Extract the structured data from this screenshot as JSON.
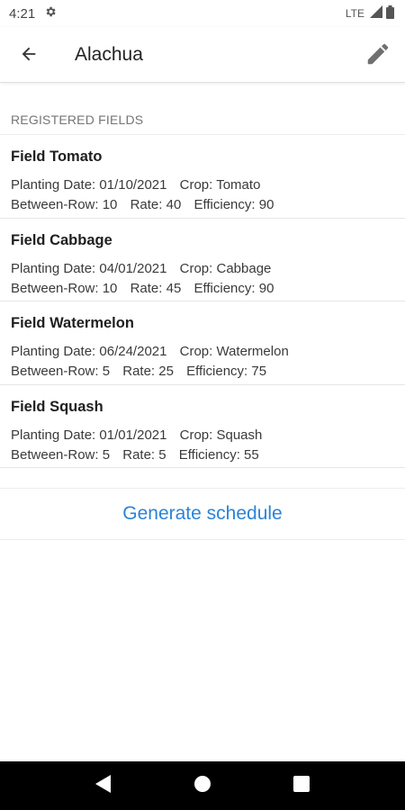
{
  "status_bar": {
    "time": "4:21",
    "network": "LTE"
  },
  "app_bar": {
    "title": "Alachua"
  },
  "section": {
    "header": "REGISTERED FIELDS"
  },
  "fields": [
    {
      "name": "Field Tomato",
      "planting_date": "Planting Date: 01/10/2021",
      "crop": "Crop: Tomato",
      "between_row": "Between-Row: 10",
      "rate": "Rate: 40",
      "efficiency": "Efficiency: 90"
    },
    {
      "name": "Field Cabbage",
      "planting_date": "Planting Date: 04/01/2021",
      "crop": "Crop: Cabbage",
      "between_row": "Between-Row: 10",
      "rate": "Rate: 45",
      "efficiency": "Efficiency: 90"
    },
    {
      "name": "Field Watermelon",
      "planting_date": "Planting Date: 06/24/2021",
      "crop": "Crop: Watermelon",
      "between_row": "Between-Row: 5",
      "rate": "Rate: 25",
      "efficiency": "Efficiency: 75"
    },
    {
      "name": "Field Squash",
      "planting_date": "Planting Date: 01/01/2021",
      "crop": "Crop: Squash",
      "between_row": "Between-Row: 5",
      "rate": "Rate: 5",
      "efficiency": "Efficiency: 55"
    }
  ],
  "actions": {
    "generate_label": "Generate schedule"
  },
  "colors": {
    "accent": "#2b83d9",
    "nav_bar": "#000000"
  },
  "icons": {
    "status": [
      "gear-icon",
      "signal-icon",
      "battery-icon"
    ],
    "app_bar": [
      "back-arrow-icon",
      "edit-pencil-icon"
    ],
    "navigation": [
      "back-triangle-icon",
      "home-circle-icon",
      "recents-square-icon"
    ]
  }
}
